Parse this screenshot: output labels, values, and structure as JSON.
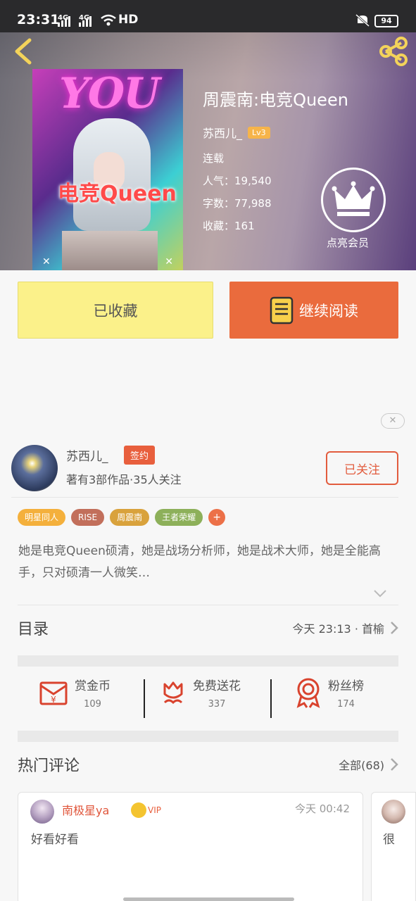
{
  "status_bar": {
    "time": "23:31",
    "signal_1": "4G",
    "signal_2": "4G",
    "network": "HD",
    "battery": "94"
  },
  "book": {
    "title": "周震南:电竞Queen",
    "author": "苏西儿_",
    "author_level": "Lv3",
    "status": "连载",
    "popularity_label": "人气：",
    "popularity": "19,540",
    "words_label": "字数：",
    "words": "77,988",
    "favorites_label": "收藏：",
    "favorites": "161",
    "vip_label": "点亮会员",
    "cover": {
      "heading": "YOU",
      "title": "电竞Queen"
    }
  },
  "actions": {
    "favorited": "已收藏",
    "continue_reading": "继续阅读"
  },
  "author_card": {
    "name": "苏西儿_",
    "badge": "签约",
    "stats": "著有3部作品·35人关注",
    "follow": "已关注"
  },
  "tags": [
    {
      "label": "明星同人",
      "color": "#f4b03c"
    },
    {
      "label": "RISE",
      "color": "#c26f5b"
    },
    {
      "label": "周震南",
      "color": "#d9a23c"
    },
    {
      "label": "王者荣耀",
      "color": "#8db05a"
    },
    {
      "label": "+",
      "color": "#ec7048"
    }
  ],
  "description": "她是电竞Queen硕清，她是战场分析师，她是战术大师，她是全能高手，只对硕清一人微笑…",
  "catalog": {
    "heading": "目录",
    "latest": "今天 23:13 · 首榆"
  },
  "rewards": [
    {
      "label": "赏金币",
      "count": "109",
      "icon": "red-envelope-icon"
    },
    {
      "label": "免费送花",
      "count": "337",
      "icon": "flower-icon"
    },
    {
      "label": "粉丝榜",
      "count": "174",
      "icon": "medal-icon"
    }
  ],
  "comments": {
    "heading": "热门评论",
    "all": "全部(68)",
    "items": [
      {
        "user": "南极星ya",
        "vip": "VIP",
        "time": "今天 00:42",
        "text": "好看好看"
      },
      {
        "text": "很"
      }
    ]
  },
  "colors": {
    "accent": "#ea6b3d",
    "favorite_bg": "#fbf18a",
    "signed": "#e85f3d"
  }
}
